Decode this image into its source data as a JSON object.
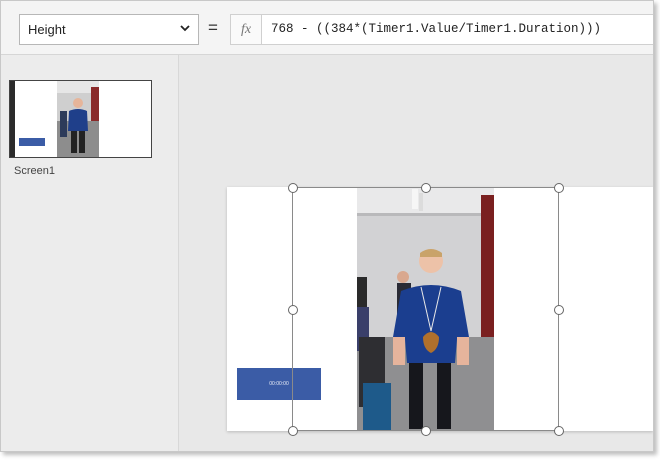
{
  "formula_bar": {
    "property": "Height",
    "equals": "=",
    "fx": "fx",
    "formula": "768 - ((384*(Timer1.Value/Timer1.Duration)))"
  },
  "screens": {
    "items": [
      {
        "label": "Screen1"
      }
    ]
  },
  "canvas": {
    "timer_button_label": "00:00:00"
  },
  "colors": {
    "accent_button": "#3b5ca6",
    "canvas_background": "#e8e8e8",
    "panel_background": "#ececec"
  },
  "icons": [
    "chevron-down-icon",
    "fx-icon",
    "selection-handle-icon"
  ]
}
